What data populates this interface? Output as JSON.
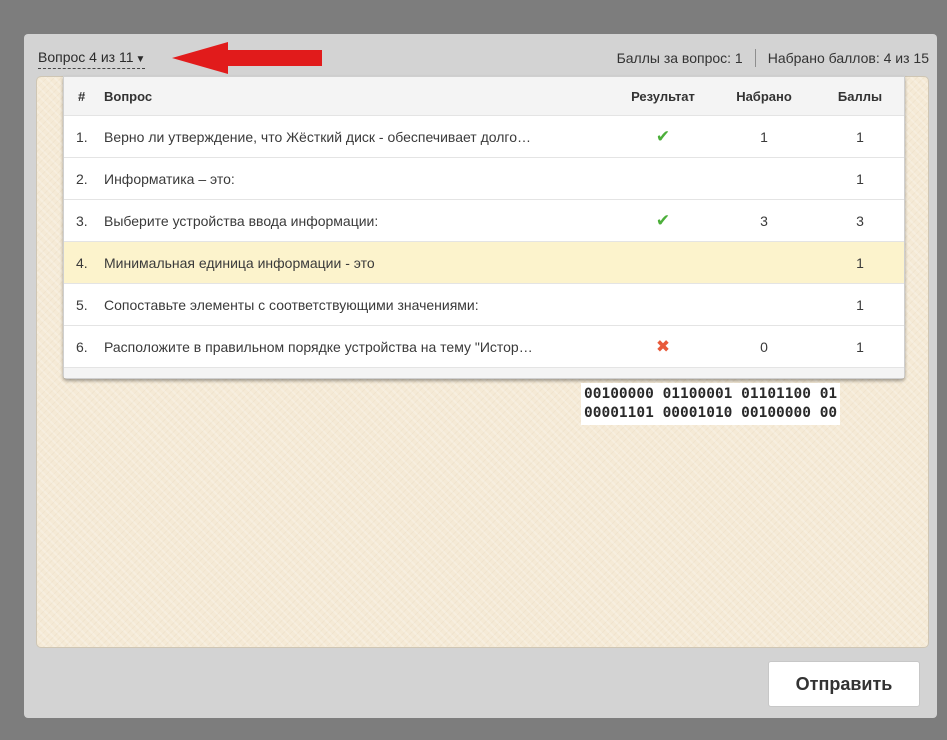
{
  "header": {
    "question_nav": "Вопрос 4 из 11",
    "caret_icon": "▼",
    "points_per_question": "Баллы за вопрос: 1",
    "points_total": "Набрано баллов: 4 из 15"
  },
  "table": {
    "columns": [
      "#",
      "Вопрос",
      "Результат",
      "Набрано",
      "Баллы"
    ],
    "rows": [
      {
        "num": "1.",
        "text": "Верно ли утверждение, что Жёсткий диск - обеспечивает долго…",
        "result": "check",
        "result_icon": "✔",
        "scored": "1",
        "points": "1"
      },
      {
        "num": "2.",
        "text": "Информатика – это:",
        "result": "",
        "result_icon": "",
        "scored": "",
        "points": "1"
      },
      {
        "num": "3.",
        "text": "Выберите устройства ввода информации:",
        "result": "check",
        "result_icon": "✔",
        "scored": "3",
        "points": "3"
      },
      {
        "num": "4.",
        "text": "Минимальная единица информации - это",
        "result": "",
        "result_icon": "",
        "scored": "",
        "points": "1"
      },
      {
        "num": "5.",
        "text": "Сопоставьте элементы с соответствующими значениями:",
        "result": "",
        "result_icon": "",
        "scored": "",
        "points": "1"
      },
      {
        "num": "6.",
        "text": "Расположите в правильном порядке устройства на тему \"Истор…",
        "result": "cross",
        "result_icon": "✖",
        "scored": "0",
        "points": "1"
      }
    ]
  },
  "binary_text": {
    "line1": "00100000 01100001 01101100 01",
    "line2": "00001101 00001010 00100000 00"
  },
  "submit_label": "Отправить",
  "colors": {
    "arrow": "#e11b1b",
    "check": "#4caf3a",
    "cross": "#e85a3a",
    "current_row": "#fcf3cc"
  }
}
